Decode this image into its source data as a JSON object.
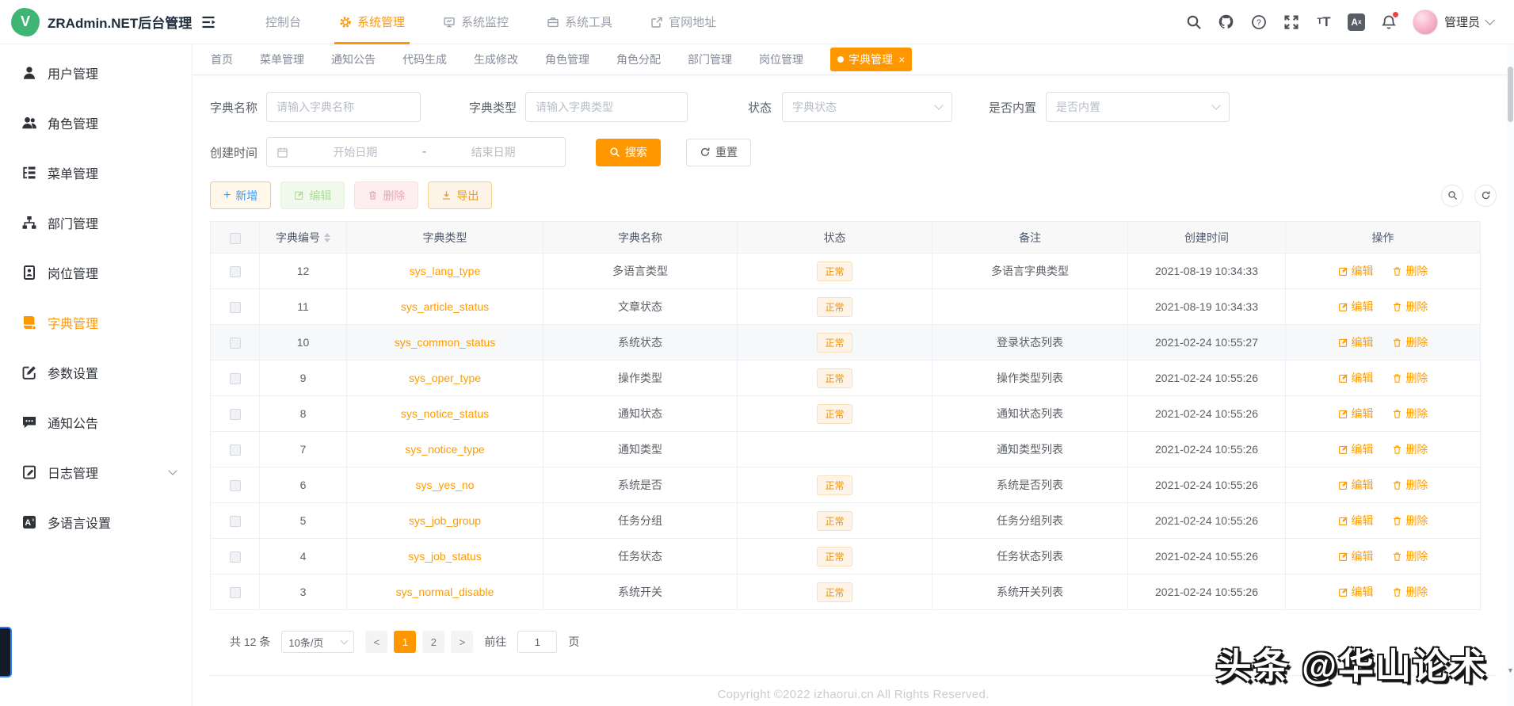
{
  "colors": {
    "accent": "#ff9700",
    "link": "#ff9c00",
    "tag-bg": "#fdf3e7",
    "tag-border": "#f9e0bb",
    "tag-text": "#f29100"
  },
  "header": {
    "logo_text": "ZRAdmin.NET后台管理",
    "nav": [
      {
        "label": "控制台",
        "icon": ""
      },
      {
        "label": "系统管理",
        "icon": "gear-icon",
        "active": true
      },
      {
        "label": "系统监控",
        "icon": "monitor-icon"
      },
      {
        "label": "系统工具",
        "icon": "briefcase-icon"
      },
      {
        "label": "官网地址",
        "icon": "external-link-icon"
      }
    ],
    "icons": [
      "search-icon",
      "github-icon",
      "help-icon",
      "fullscreen-icon",
      "font-size-icon",
      "language-icon",
      "bell-icon"
    ],
    "user_name": "管理员"
  },
  "sidebar": {
    "items": [
      {
        "label": "用户管理",
        "icon": "user-icon"
      },
      {
        "label": "角色管理",
        "icon": "roles-icon"
      },
      {
        "label": "菜单管理",
        "icon": "menu-list-icon"
      },
      {
        "label": "部门管理",
        "icon": "org-tree-icon"
      },
      {
        "label": "岗位管理",
        "icon": "id-badge-icon"
      },
      {
        "label": "字典管理",
        "icon": "dictionary-icon",
        "active": true
      },
      {
        "label": "参数设置",
        "icon": "edit-square-icon"
      },
      {
        "label": "通知公告",
        "icon": "chat-bubble-icon"
      },
      {
        "label": "日志管理",
        "icon": "log-icon",
        "expandable": true
      },
      {
        "label": "多语言设置",
        "icon": "translate-icon"
      }
    ]
  },
  "tabs": [
    {
      "label": "首页"
    },
    {
      "label": "菜单管理"
    },
    {
      "label": "通知公告"
    },
    {
      "label": "代码生成"
    },
    {
      "label": "生成修改"
    },
    {
      "label": "角色管理"
    },
    {
      "label": "角色分配"
    },
    {
      "label": "部门管理"
    },
    {
      "label": "岗位管理"
    },
    {
      "label": "字典管理",
      "active": true,
      "closable": true
    }
  ],
  "filters": {
    "dict_name_label": "字典名称",
    "dict_name_placeholder": "请输入字典名称",
    "dict_type_label": "字典类型",
    "dict_type_placeholder": "请输入字典类型",
    "status_label": "状态",
    "status_placeholder": "字典状态",
    "builtin_label": "是否内置",
    "builtin_placeholder": "是否内置",
    "create_time_label": "创建时间",
    "date_start_placeholder": "开始日期",
    "date_separator": "-",
    "date_end_placeholder": "结束日期",
    "search_label": "搜索",
    "reset_label": "重置"
  },
  "toolbar": {
    "add_label": "新增",
    "edit_label": "编辑",
    "delete_label": "删除",
    "export_label": "导出"
  },
  "table": {
    "columns": [
      "字典编号",
      "字典类型",
      "字典名称",
      "状态",
      "备注",
      "创建时间",
      "操作"
    ],
    "actions": {
      "edit": "编辑",
      "delete": "删除"
    },
    "rows": [
      {
        "id": "12",
        "type": "sys_lang_type",
        "name": "多语言类型",
        "status": "正常",
        "remark": "多语言字典类型",
        "time": "2021-08-19 10:34:33"
      },
      {
        "id": "11",
        "type": "sys_article_status",
        "name": "文章状态",
        "status": "正常",
        "remark": "",
        "time": "2021-08-19 10:34:33"
      },
      {
        "id": "10",
        "type": "sys_common_status",
        "name": "系统状态",
        "status": "正常",
        "remark": "登录状态列表",
        "time": "2021-02-24 10:55:27",
        "highlight": true
      },
      {
        "id": "9",
        "type": "sys_oper_type",
        "name": "操作类型",
        "status": "正常",
        "remark": "操作类型列表",
        "time": "2021-02-24 10:55:26"
      },
      {
        "id": "8",
        "type": "sys_notice_status",
        "name": "通知状态",
        "status": "正常",
        "remark": "通知状态列表",
        "time": "2021-02-24 10:55:26"
      },
      {
        "id": "7",
        "type": "sys_notice_type",
        "name": "通知类型",
        "status": "",
        "remark": "通知类型列表",
        "time": "2021-02-24 10:55:26"
      },
      {
        "id": "6",
        "type": "sys_yes_no",
        "name": "系统是否",
        "status": "正常",
        "remark": "系统是否列表",
        "time": "2021-02-24 10:55:26"
      },
      {
        "id": "5",
        "type": "sys_job_group",
        "name": "任务分组",
        "status": "正常",
        "remark": "任务分组列表",
        "time": "2021-02-24 10:55:26"
      },
      {
        "id": "4",
        "type": "sys_job_status",
        "name": "任务状态",
        "status": "正常",
        "remark": "任务状态列表",
        "time": "2021-02-24 10:55:26"
      },
      {
        "id": "3",
        "type": "sys_normal_disable",
        "name": "系统开关",
        "status": "正常",
        "remark": "系统开关列表",
        "time": "2021-02-24 10:55:26"
      }
    ]
  },
  "pagination": {
    "total_text": "共 12 条",
    "page_size": "10条/页",
    "pages": [
      "1",
      "2"
    ],
    "current_page": "1",
    "goto_label": "前往",
    "goto_value": "1",
    "page_unit": "页"
  },
  "footer": {
    "copyright": "Copyright ©2022 izhaorui.cn All Rights Reserved."
  },
  "watermark": "头条 @华山论术"
}
